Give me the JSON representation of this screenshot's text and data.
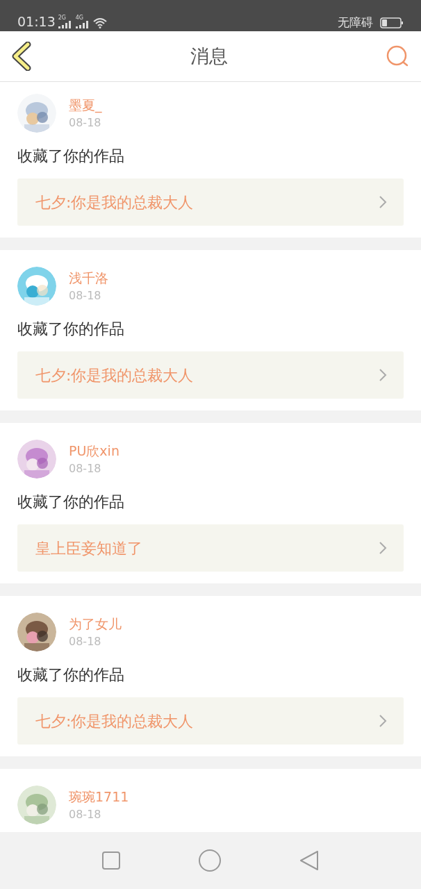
{
  "status_bar": {
    "time": "01:13",
    "network_1": "2G",
    "network_2": "4G",
    "label": "无障碍"
  },
  "header": {
    "title": "消息"
  },
  "messages": [
    {
      "user": "墨夏_",
      "date": "08-18",
      "action": "收藏了你的作品",
      "work": "七夕:你是我的总裁大人"
    },
    {
      "user": "浅千洛",
      "date": "08-18",
      "action": "收藏了你的作品",
      "work": "七夕:你是我的总裁大人"
    },
    {
      "user": "PU欣xin",
      "date": "08-18",
      "action": "收藏了你的作品",
      "work": "皇上臣妾知道了"
    },
    {
      "user": "为了女儿",
      "date": "08-18",
      "action": "收藏了你的作品",
      "work": "七夕:你是我的总裁大人"
    },
    {
      "user": "琬琬1711",
      "date": "08-18"
    }
  ]
}
